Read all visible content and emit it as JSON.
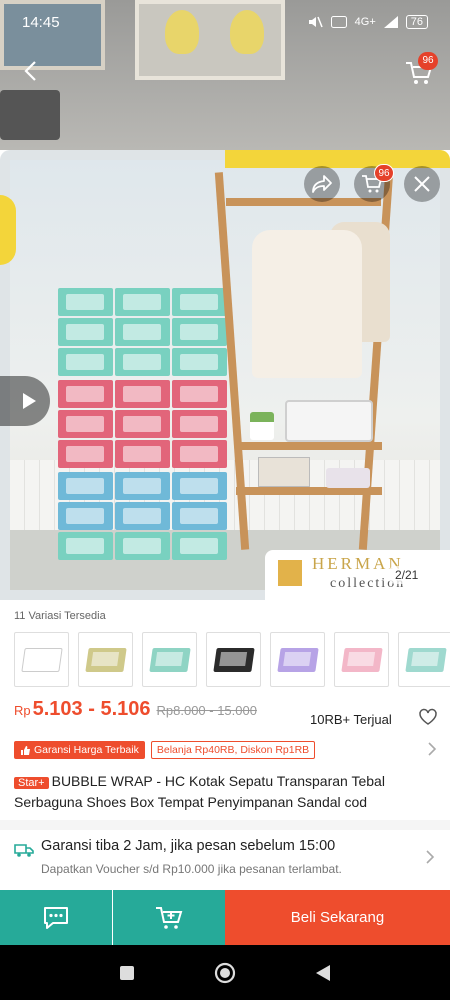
{
  "status_bar": {
    "time": "14:45",
    "network": "4G+",
    "battery": "76"
  },
  "header": {
    "cart_badge": "96"
  },
  "gallery": {
    "image_counter": "2/21",
    "cart_badge": "96",
    "brand_name": "HERMAN",
    "brand_sub": "collection"
  },
  "variations": {
    "title": "11 Variasi Tersedia",
    "colors": [
      "#ffffff",
      "#cfc98a",
      "#8fd4c4",
      "#2b2b2b",
      "#b7a3e6",
      "#f3b7c8",
      "#9fd9cf"
    ]
  },
  "price": {
    "currency": "Rp",
    "range": "5.103 - 5.106",
    "original": "Rp8.000 - 15.000",
    "sold": "10RB+ Terjual"
  },
  "promo": {
    "guarantee": "Garansi Harga Terbaik",
    "voucher": "Belanja Rp40RB, Diskon Rp1RB"
  },
  "product": {
    "badge": "Star+",
    "title": "BUBBLE WRAP - HC Kotak Sepatu Transparan Tebal Serbaguna Shoes Box Tempat Penyimpanan Sandal cod"
  },
  "shipping": {
    "main": "Garansi tiba 2 Jam, jika pesan sebelum 15:00",
    "sub": "Dapatkan Voucher s/d Rp10.000 jika pesanan terlambat."
  },
  "actions": {
    "buy_label": "Beli Sekarang"
  },
  "theme": {
    "accent": "#ee4d2d",
    "teal": "#26aa99"
  }
}
